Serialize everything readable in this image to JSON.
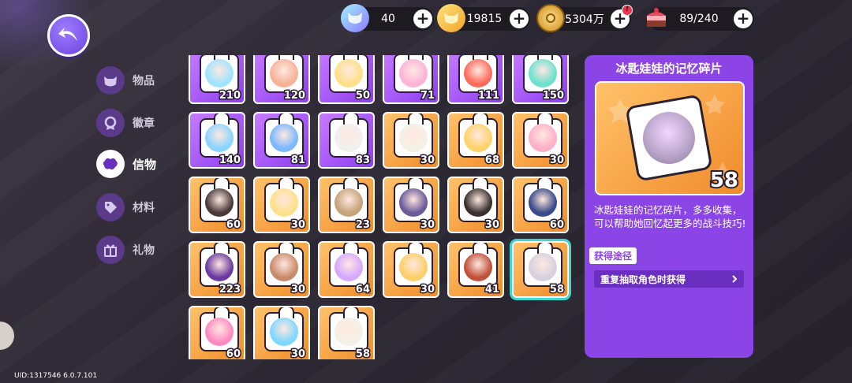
{
  "currencies": [
    {
      "icon": "cat-gem-icon",
      "value": "40",
      "color": "#7fd4ff"
    },
    {
      "icon": "cat-coin-icon",
      "value": "19815",
      "color": "#ffc94a"
    },
    {
      "icon": "gold-coin-icon",
      "value": "5304万",
      "color": "#e6b33c",
      "alert": "!"
    },
    {
      "icon": "cake-icon",
      "value": "89/240",
      "color": "#e84a5f"
    }
  ],
  "nav": [
    {
      "label": "物品",
      "icon": "cat-bag-icon",
      "active": false
    },
    {
      "label": "徽章",
      "icon": "medal-icon",
      "active": false
    },
    {
      "label": "信物",
      "icon": "token-icon",
      "active": true
    },
    {
      "label": "材料",
      "icon": "material-tag-icon",
      "active": false
    },
    {
      "label": "礼物",
      "icon": "gift-icon",
      "active": false
    }
  ],
  "tiles": [
    {
      "count": "210",
      "color": "purple",
      "tint": "#9fe3ff"
    },
    {
      "count": "120",
      "color": "purple",
      "tint": "#f5b39a"
    },
    {
      "count": "50",
      "color": "purple",
      "tint": "#ffe08a"
    },
    {
      "count": "71",
      "color": "purple",
      "tint": "#ffb3d9"
    },
    {
      "count": "111",
      "color": "purple",
      "tint": "#ff6b5b"
    },
    {
      "count": "150",
      "color": "purple",
      "tint": "#6fe0d0"
    },
    {
      "count": "140",
      "color": "purple",
      "tint": "#8ad4ff"
    },
    {
      "count": "81",
      "color": "purple",
      "tint": "#7ab8ff"
    },
    {
      "count": "83",
      "color": "purple",
      "tint": "#f0f0f0"
    },
    {
      "count": "30",
      "color": "orange",
      "tint": "#f5f0e6"
    },
    {
      "count": "68",
      "color": "orange",
      "tint": "#ffd36b"
    },
    {
      "count": "30",
      "color": "orange",
      "tint": "#ffb0c8"
    },
    {
      "count": "60",
      "color": "orange",
      "tint": "#4a3a3a"
    },
    {
      "count": "30",
      "color": "orange",
      "tint": "#ffe08a"
    },
    {
      "count": "23",
      "color": "orange",
      "tint": "#c7a37a"
    },
    {
      "count": "30",
      "color": "orange",
      "tint": "#6a5a9a"
    },
    {
      "count": "30",
      "color": "orange",
      "tint": "#3a3030"
    },
    {
      "count": "60",
      "color": "orange",
      "tint": "#3a4a8a"
    },
    {
      "count": "223",
      "color": "orange",
      "tint": "#6a3aa0"
    },
    {
      "count": "30",
      "color": "orange",
      "tint": "#c98a6a"
    },
    {
      "count": "64",
      "color": "orange",
      "tint": "#d6a8ff"
    },
    {
      "count": "30",
      "color": "orange",
      "tint": "#ffcf6a"
    },
    {
      "count": "41",
      "color": "orange",
      "tint": "#c0503a"
    },
    {
      "count": "58",
      "color": "orange",
      "tint": "#d8d0e0",
      "selected": true
    },
    {
      "count": "60",
      "color": "orange",
      "tint": "#ff8ac2"
    },
    {
      "count": "30",
      "color": "orange",
      "tint": "#7fd8ff"
    },
    {
      "count": "58",
      "color": "orange",
      "tint": "#f5f0e6"
    }
  ],
  "detail": {
    "title": "冰匙娃娃的记忆碎片",
    "count": "58",
    "description": "冰匙娃娃的记忆碎片，多多收集，可以帮助她回忆起更多的战斗技巧!",
    "obtain_label": "获得途径",
    "obtain_source": "重复抽取角色时获得"
  },
  "uid": "UID:1317546 6.0.7.101"
}
